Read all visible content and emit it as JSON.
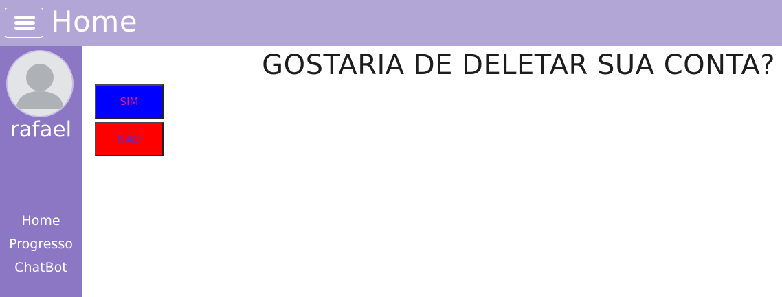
{
  "topbar": {
    "title": "Home",
    "menu_icon": "hamburger-menu-icon"
  },
  "sidebar": {
    "avatar_icon": "user-avatar-icon",
    "username": "rafael",
    "nav": [
      {
        "label": "Home"
      },
      {
        "label": "Progresso"
      },
      {
        "label": "ChatBot"
      }
    ]
  },
  "main": {
    "headline": "GOSTARIA DE DELETAR SUA CONTA?",
    "yes_label": "SIM",
    "no_label": "NÃO"
  },
  "colors": {
    "topbar": "#b2a6d6",
    "sidebar": "#8b77c4",
    "yes_button_bg": "#0000ff",
    "yes_button_text": "#e8187a",
    "no_button_bg": "#ff0000",
    "no_button_text": "#5b2bd6"
  }
}
